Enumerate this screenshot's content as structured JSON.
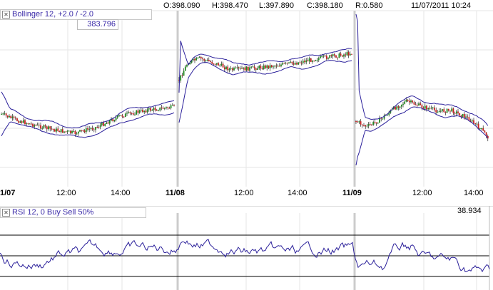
{
  "header": {
    "open": "O:398.090",
    "high": "H:398.470",
    "low": "L:397.890",
    "close": "C:398.180",
    "range": "R:0.580",
    "datetime": "11/07/2011 10:24"
  },
  "price_panel": {
    "indicator_label": "Bollinger 12, +2.0 / -2.0",
    "indicator_value": "383.796",
    "close_icon": "close-icon"
  },
  "x_axis": [
    {
      "label": "1/07",
      "bold": true
    },
    {
      "label": "12:00",
      "bold": false
    },
    {
      "label": "14:00",
      "bold": false
    },
    {
      "label": "11/08",
      "bold": true
    },
    {
      "label": "12:00",
      "bold": false
    },
    {
      "label": "14:00",
      "bold": false
    },
    {
      "label": "11/09",
      "bold": true
    },
    {
      "label": "12:00",
      "bold": false
    },
    {
      "label": "14:00",
      "bold": false
    }
  ],
  "rsi_panel": {
    "indicator_label": "RSI 12, 0 Buy Sell 50%",
    "value": "38.934",
    "close_icon": "close-icon"
  },
  "colors": {
    "bollinger": "#2a1f9a",
    "candle_up": "#1f8a1f",
    "candle_down": "#c81e1e",
    "rsi_line": "#2a1f9a",
    "grid": "#e6e6e6",
    "session_line": "#cccccc"
  }
}
